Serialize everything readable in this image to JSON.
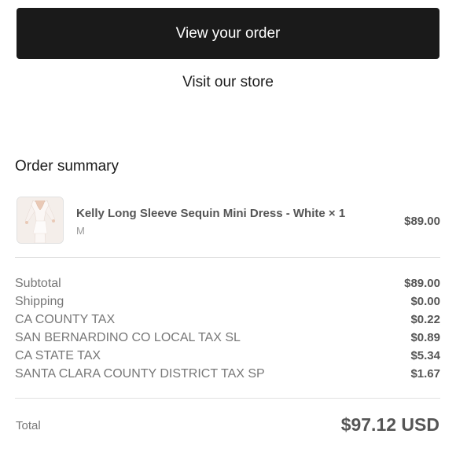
{
  "actions": {
    "view_order_label": "View your order",
    "visit_store_label": "Visit our store"
  },
  "summary": {
    "title": "Order summary",
    "items": [
      {
        "name": "Kelly Long Sleeve Sequin Mini Dress - White × 1",
        "variant": "M",
        "price": "$89.00",
        "thumbnail_icon": "dress-product-photo"
      }
    ],
    "lines": [
      {
        "label": "Subtotal",
        "value": "$89.00"
      },
      {
        "label": "Shipping",
        "value": "$0.00"
      },
      {
        "label": "CA COUNTY TAX",
        "value": "$0.22"
      },
      {
        "label": "SAN BERNARDINO CO LOCAL TAX SL",
        "value": "$0.89"
      },
      {
        "label": "CA STATE TAX",
        "value": "$5.34"
      },
      {
        "label": "SANTA CLARA COUNTY DISTRICT TAX SP",
        "value": "$1.67"
      }
    ],
    "total": {
      "label": "Total",
      "value": "$97.12 USD"
    }
  },
  "colors": {
    "button_bg": "#1a1a1a",
    "button_text": "#ffffff",
    "divider": "#e1e1e1",
    "muted_text": "#777777",
    "strong_text": "#555555"
  }
}
